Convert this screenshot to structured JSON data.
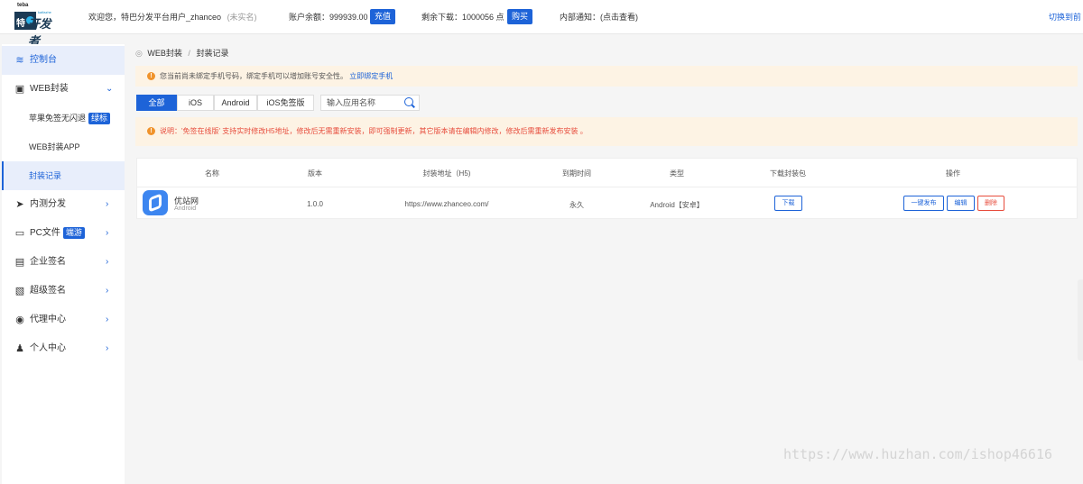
{
  "header": {
    "logo_small": "teba",
    "logo_small2": "kaifazhe",
    "logo_char": "特",
    "logo_main": "开发者",
    "welcome_prefix": "欢迎您，特巴分发平台用户_zhanceo",
    "verify_status": "(未实名)",
    "balance_text": "账户余额：999939.00",
    "recharge_label": "充值",
    "downloads_text": "剩余下载：1000056 点",
    "buy_label": "购买",
    "notice_text": "内部通知：(点击查看)",
    "switch_label": "切换到前"
  },
  "sidebar": {
    "items": [
      {
        "label": "控制台",
        "icon": "layers-icon",
        "active": true
      },
      {
        "label": "WEB封装",
        "icon": "box-icon",
        "expanded": true
      },
      {
        "label": "内测分发",
        "icon": "send-icon"
      },
      {
        "label": "PC文件",
        "icon": "desktop-icon",
        "badge": "端游"
      },
      {
        "label": "企业签名",
        "icon": "clipboard-icon"
      },
      {
        "label": "超级签名",
        "icon": "document-icon"
      },
      {
        "label": "代理中心",
        "icon": "agent-icon"
      },
      {
        "label": "个人中心",
        "icon": "user-icon"
      }
    ],
    "subitems": [
      {
        "label": "苹果免签无闪退",
        "badge": "绿标"
      },
      {
        "label": "WEB封装APP"
      },
      {
        "label": "封装记录",
        "active": true
      }
    ]
  },
  "breadcrumb": {
    "root": "WEB封装",
    "separator": "/",
    "current": "封装记录"
  },
  "alerts": {
    "phone_text": "您当前尚未绑定手机号码，绑定手机可以增加账号安全性。",
    "phone_link": "立即绑定手机",
    "note_text": "说明：'免签在线版' 支持实时修改H5地址，修改后无需重新安装，即可强制更新，其它版本请在编辑内修改，修改后需重新发布安装 。"
  },
  "filter": {
    "tabs": [
      "全部",
      "iOS",
      "Android",
      "iOS免签版"
    ],
    "active_tab": 0,
    "search_placeholder": "输入应用名称"
  },
  "table": {
    "columns": [
      "名称",
      "版本",
      "封装地址（H5)",
      "到期时间",
      "类型",
      "下载封装包",
      "操作"
    ],
    "rows": [
      {
        "name": "优站网",
        "platform": "Android",
        "version": "1.0.0",
        "url": "https://www.zhanceo.com/",
        "expiry": "永久",
        "type": "Android【安卓】",
        "download_label": "下载",
        "actions": [
          "一键发布",
          "编辑",
          "删除"
        ]
      }
    ]
  },
  "watermark": "https://www.huzhan.com/ishop46616",
  "colors": {
    "accent": "#1d63d8",
    "warning_bg": "#fdf3e4",
    "warning": "#f0932b",
    "danger": "#e74c3c"
  }
}
